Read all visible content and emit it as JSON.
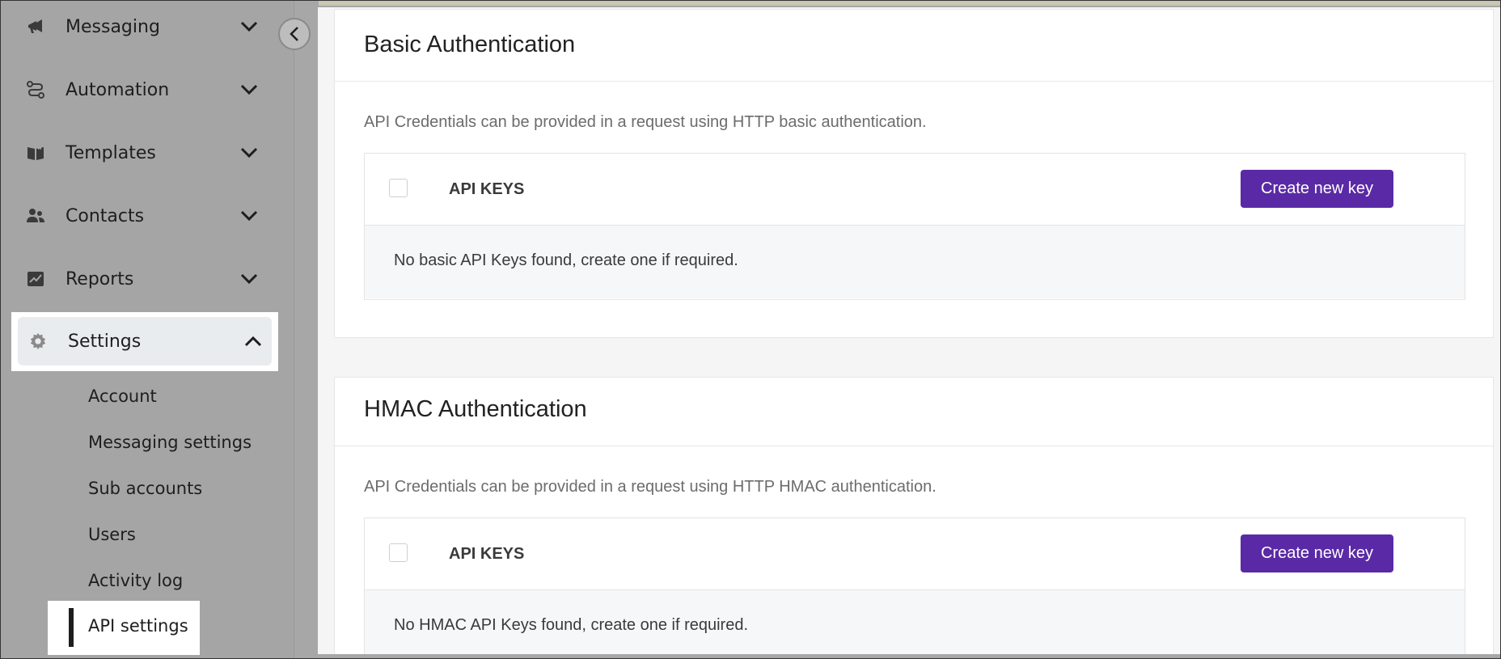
{
  "sidebar": {
    "items": [
      {
        "label": "Messaging",
        "icon": "megaphone-icon"
      },
      {
        "label": "Automation",
        "icon": "route-icon"
      },
      {
        "label": "Templates",
        "icon": "book-icon"
      },
      {
        "label": "Contacts",
        "icon": "users-icon"
      },
      {
        "label": "Reports",
        "icon": "chart-icon"
      }
    ],
    "settings": {
      "label": "Settings",
      "icon": "gear-icon",
      "expanded": true
    },
    "sub_items": [
      {
        "label": "Account"
      },
      {
        "label": "Messaging settings"
      },
      {
        "label": "Sub accounts"
      },
      {
        "label": "Users"
      },
      {
        "label": "Activity log"
      },
      {
        "label": "API settings",
        "active": true
      }
    ]
  },
  "basic": {
    "title": "Basic Authentication",
    "description": "API Credentials can be provided in a request using HTTP basic authentication.",
    "keys_label": "API KEYS",
    "button": "Create new key",
    "empty": "No basic API Keys found, create one if required."
  },
  "hmac": {
    "title": "HMAC Authentication",
    "description": "API Credentials can be provided in a request using HTTP HMAC authentication.",
    "keys_label": "API KEYS",
    "button": "Create new key",
    "empty": "No HMAC API Keys found, create one if required."
  },
  "colors": {
    "accent": "#5a2aa6",
    "sidebar": "#a5a5a5"
  }
}
